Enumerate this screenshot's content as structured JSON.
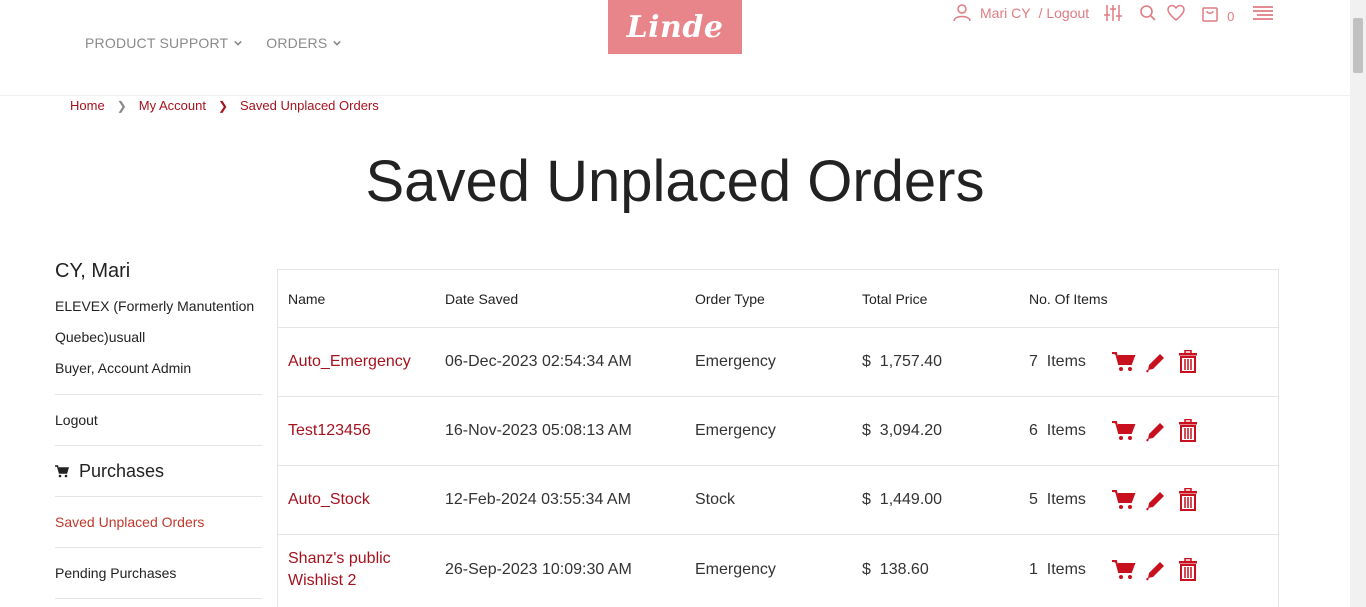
{
  "header": {
    "nav": [
      {
        "label": "PRODUCT SUPPORT"
      },
      {
        "label": "ORDERS"
      }
    ],
    "logo_text": "Linde",
    "user_name": "Mari CY",
    "logout": "/ Logout",
    "cart_count": "0"
  },
  "breadcrumb": {
    "home": "Home",
    "account": "My Account",
    "current": "Saved Unplaced Orders"
  },
  "page_title": "Saved Unplaced Orders",
  "sidebar": {
    "name": "CY, Mari",
    "company_line1": "ELEVEX (Formerly Manutention",
    "company_line2": "Quebec)usuall",
    "role": "Buyer, Account Admin",
    "logout": "Logout",
    "section": "Purchases",
    "active_link": "Saved Unplaced Orders",
    "pending": "Pending Purchases"
  },
  "table": {
    "headers": {
      "name": "Name",
      "date": "Date Saved",
      "type": "Order Type",
      "price": "Total Price",
      "items": "No. Of Items"
    },
    "rows": [
      {
        "name": "Auto_Emergency",
        "date": "06-Dec-2023 02:54:34 AM",
        "type": "Emergency",
        "price": "$  1,757.40",
        "items": "7  Items"
      },
      {
        "name": "Test123456",
        "date": "16-Nov-2023 05:08:13 AM",
        "type": "Emergency",
        "price": "$  3,094.20",
        "items": "6  Items"
      },
      {
        "name": "Auto_Stock",
        "date": "12-Feb-2024 03:55:34 AM",
        "type": "Stock",
        "price": "$  1,449.00",
        "items": "5  Items"
      },
      {
        "name": "Shanz's public Wishlist 2",
        "date": "26-Sep-2023 10:09:30 AM",
        "type": "Emergency",
        "price": "$  138.60",
        "items": "1  Items"
      }
    ]
  },
  "colors": {
    "accent": "#a5121e",
    "icon_red": "#c8101e",
    "logo_bg": "#e8858a",
    "header_pink": "#e07b82"
  }
}
